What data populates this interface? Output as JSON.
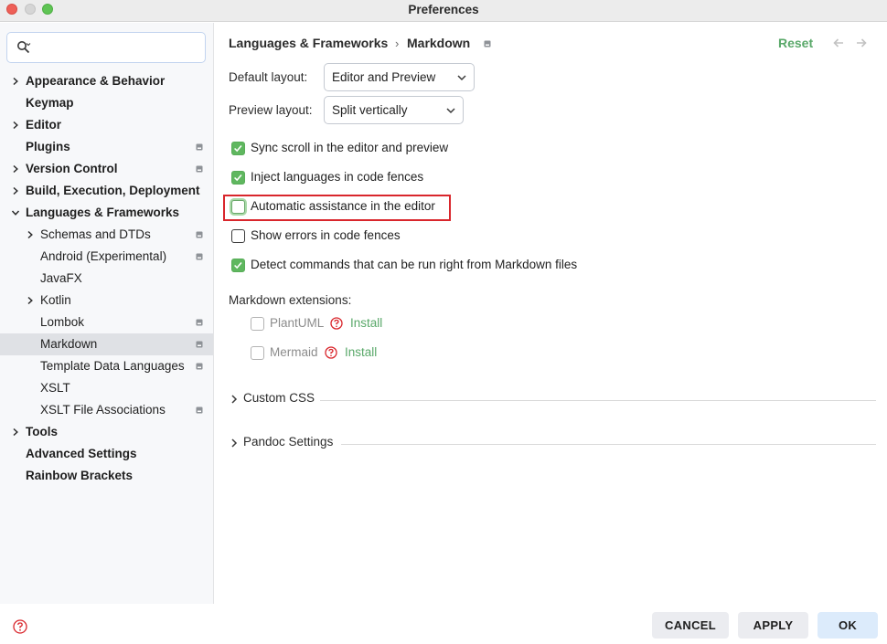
{
  "window": {
    "title": "Preferences"
  },
  "search": {
    "placeholder": ""
  },
  "sidebar": {
    "items": [
      {
        "label": "Appearance & Behavior",
        "bold": true,
        "indent": 0,
        "chevron": "right",
        "badge": false,
        "selected": false
      },
      {
        "label": "Keymap",
        "bold": true,
        "indent": 0,
        "chevron": "none",
        "badge": false,
        "selected": false
      },
      {
        "label": "Editor",
        "bold": true,
        "indent": 0,
        "chevron": "right",
        "badge": false,
        "selected": false
      },
      {
        "label": "Plugins",
        "bold": true,
        "indent": 0,
        "chevron": "none",
        "badge": true,
        "selected": false
      },
      {
        "label": "Version Control",
        "bold": true,
        "indent": 0,
        "chevron": "right",
        "badge": true,
        "selected": false
      },
      {
        "label": "Build, Execution, Deployment",
        "bold": true,
        "indent": 0,
        "chevron": "right",
        "badge": false,
        "selected": false
      },
      {
        "label": "Languages & Frameworks",
        "bold": true,
        "indent": 0,
        "chevron": "down",
        "badge": false,
        "selected": false
      },
      {
        "label": "Schemas and DTDs",
        "bold": false,
        "indent": 1,
        "chevron": "right",
        "badge": true,
        "selected": false
      },
      {
        "label": "Android (Experimental)",
        "bold": false,
        "indent": 1,
        "chevron": "none",
        "badge": true,
        "selected": false
      },
      {
        "label": "JavaFX",
        "bold": false,
        "indent": 1,
        "chevron": "none",
        "badge": false,
        "selected": false
      },
      {
        "label": "Kotlin",
        "bold": false,
        "indent": 1,
        "chevron": "right",
        "badge": false,
        "selected": false
      },
      {
        "label": "Lombok",
        "bold": false,
        "indent": 1,
        "chevron": "none",
        "badge": true,
        "selected": false
      },
      {
        "label": "Markdown",
        "bold": false,
        "indent": 1,
        "chevron": "none",
        "badge": true,
        "selected": true
      },
      {
        "label": "Template Data Languages",
        "bold": false,
        "indent": 1,
        "chevron": "none",
        "badge": true,
        "selected": false
      },
      {
        "label": "XSLT",
        "bold": false,
        "indent": 1,
        "chevron": "none",
        "badge": false,
        "selected": false
      },
      {
        "label": "XSLT File Associations",
        "bold": false,
        "indent": 1,
        "chevron": "none",
        "badge": true,
        "selected": false
      },
      {
        "label": "Tools",
        "bold": true,
        "indent": 0,
        "chevron": "right",
        "badge": false,
        "selected": false
      },
      {
        "label": "Advanced Settings",
        "bold": true,
        "indent": 0,
        "chevron": "none",
        "badge": false,
        "selected": false
      },
      {
        "label": "Rainbow Brackets",
        "bold": true,
        "indent": 0,
        "chevron": "none",
        "badge": false,
        "selected": false
      }
    ]
  },
  "header": {
    "breadcrumb_parent": "Languages & Frameworks",
    "breadcrumb_separator": "›",
    "breadcrumb_current": "Markdown",
    "reset_label": "Reset"
  },
  "form": {
    "default_layout_label": "Default layout:",
    "default_layout_value": "Editor and Preview",
    "preview_layout_label": "Preview layout:",
    "preview_layout_value": "Split vertically",
    "options": [
      {
        "label": "Sync scroll in the editor and preview",
        "checked": true
      },
      {
        "label": "Inject languages in code fences",
        "checked": true
      },
      {
        "label": "Automatic assistance in the editor",
        "checked": false
      },
      {
        "label": "Show errors in code fences",
        "checked": false
      },
      {
        "label": "Detect commands that can be run right from Markdown files",
        "checked": true
      }
    ],
    "extensions_label": "Markdown extensions:",
    "extensions": [
      {
        "label": "PlantUML",
        "install_label": "Install",
        "enabled": false
      },
      {
        "label": "Mermaid",
        "install_label": "Install",
        "enabled": false
      }
    ],
    "sections": [
      {
        "label": "Custom CSS"
      },
      {
        "label": "Pandoc Settings"
      }
    ]
  },
  "footer": {
    "cancel_label": "CANCEL",
    "apply_label": "APPLY",
    "ok_label": "OK"
  },
  "colors": {
    "accent_green": "#59a869",
    "highlight_red": "#d9262c",
    "selection_bg": "#dfe1e5",
    "primary_button_bg": "#dcebfb"
  }
}
